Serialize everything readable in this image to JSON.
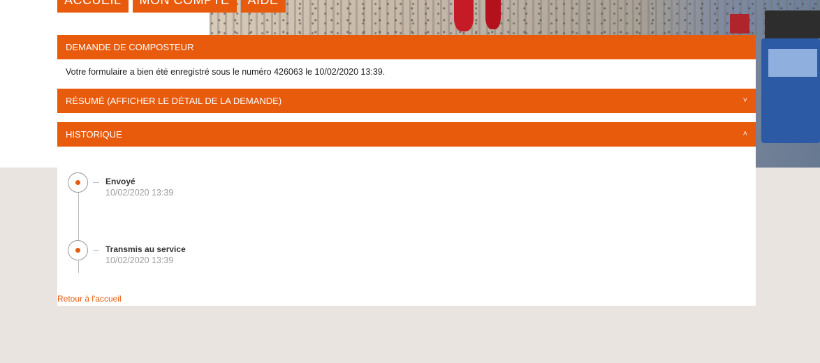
{
  "nav": {
    "items": [
      "ACCUEIL",
      "MON COMPTE",
      "AIDE"
    ]
  },
  "demande": {
    "title": "DEMANDE DE COMPOSTEUR",
    "confirmation": "Votre formulaire a bien été enregistré sous le numéro 426063 le 10/02/2020 13:39."
  },
  "resume": {
    "title": "RÉSUMÉ  (AFFICHER LE DÉTAIL DE LA DEMANDE)",
    "chevron": "˅",
    "icon": "chevron-down-icon"
  },
  "historique": {
    "title": "HISTORIQUE",
    "chevron": "˄",
    "icon": "chevron-up-icon",
    "events": [
      {
        "label": "Envoyé",
        "date": "10/02/2020 13:39"
      },
      {
        "label": "Transmis au service",
        "date": "10/02/2020 13:39"
      }
    ]
  },
  "footer": {
    "back_link": "Retour à l'accueil"
  },
  "colors": {
    "accent": "#e85a0c",
    "page_bg": "#e9e4df"
  }
}
